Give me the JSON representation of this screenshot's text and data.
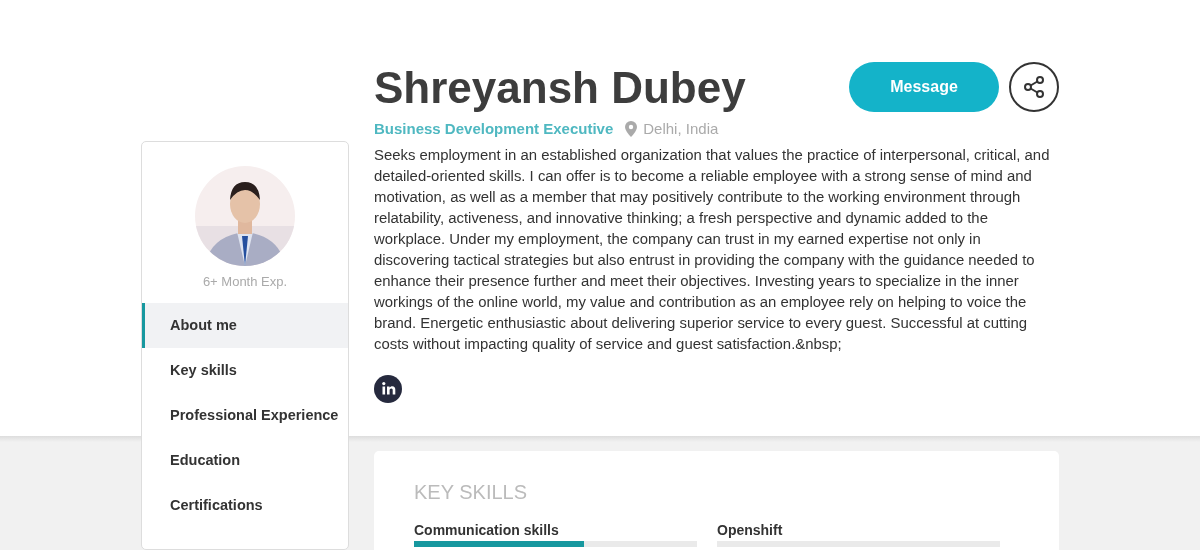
{
  "profile": {
    "name": "Shreyansh Dubey",
    "title": "Business Development Executive",
    "location": "Delhi, India",
    "experience": "6+ Month Exp.",
    "about": "Seeks employment in an established organization that values the practice of interpersonal, critical, and detailed-oriented skills. I can offer is to become a reliable employee with a strong sense of mind and motivation, as well as a member that may positively contribute to the working environment through relatability, activeness, and innovative thinking; a fresh perspective and dynamic added to the workplace. Under my employment, the company can trust in my earned expertise not only in discovering tactical strategies but also entrust in providing the company with the guidance needed to enhance their presence further and meet their objectives. Investing years to specialize in the inner workings of the online world, my value and contribution as an employee rely on helping to voice the brand. Energetic enthusiastic about delivering superior service to every guest. Successful at cutting costs without impacting quality of service and guest satisfaction.&nbsp;"
  },
  "buttons": {
    "message": "Message"
  },
  "sidebar": {
    "items": [
      {
        "label": "About me",
        "selected": true
      },
      {
        "label": "Key skills",
        "selected": false
      },
      {
        "label": "Professional Experience",
        "selected": false
      },
      {
        "label": "Education",
        "selected": false
      },
      {
        "label": "Certifications",
        "selected": false
      }
    ]
  },
  "key_skills": {
    "heading": "KEY SKILLS",
    "skills": [
      {
        "name": "Communication skills",
        "level": 0.6
      },
      {
        "name": "Openshift",
        "level": 0
      }
    ]
  }
}
